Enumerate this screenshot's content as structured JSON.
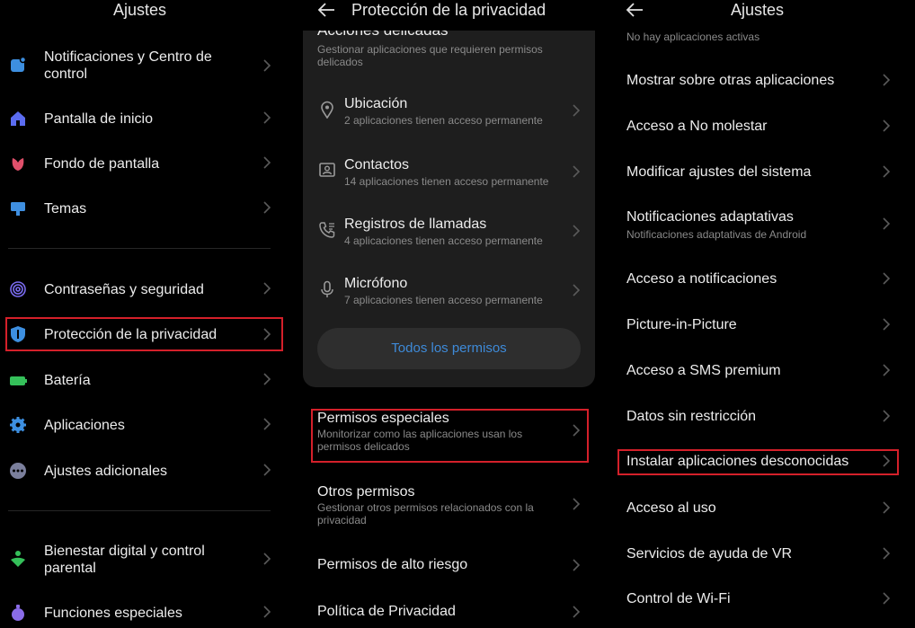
{
  "panel1": {
    "title": "Ajustes",
    "items": [
      {
        "label": "Notificaciones y Centro de",
        "label2": "control"
      },
      {
        "label": "Pantalla de inicio"
      },
      {
        "label": "Fondo de pantalla"
      },
      {
        "label": "Temas"
      },
      {
        "label": "Contraseñas y seguridad"
      },
      {
        "label": "Protección de la privacidad"
      },
      {
        "label": "Batería"
      },
      {
        "label": "Aplicaciones"
      },
      {
        "label": "Ajustes adicionales"
      },
      {
        "label": "Bienestar digital y control",
        "label2": "parental"
      },
      {
        "label": "Funciones especiales"
      }
    ]
  },
  "panel2": {
    "title": "Protección de la privacidad",
    "section_title": "Acciones delicadas",
    "section_sub1": "Gestionar aplicaciones que requieren permisos",
    "section_sub2": "delicados",
    "perms": [
      {
        "label": "Ubicación",
        "sub": "2 aplicaciones tienen acceso permanente"
      },
      {
        "label": "Contactos",
        "sub": "14 aplicaciones tienen acceso permanente"
      },
      {
        "label": "Registros de llamadas",
        "sub": "4 aplicaciones tienen acceso permanente"
      },
      {
        "label": "Micrófono",
        "sub": "7 aplicaciones tienen acceso permanente"
      }
    ],
    "all_perms": "Todos los permisos",
    "special": {
      "label": "Permisos especiales",
      "sub1": "Monitorizar como las aplicaciones usan los",
      "sub2": "permisos delicados"
    },
    "other": {
      "label": "Otros permisos",
      "sub1": "Gestionar otros permisos relacionados con la",
      "sub2": "privacidad"
    },
    "high_risk": "Permisos de alto riesgo",
    "policy": "Política de Privacidad"
  },
  "panel3": {
    "title": "Ajustes",
    "top_sub": "No hay aplicaciones activas",
    "items": [
      {
        "label": "Mostrar sobre otras aplicaciones"
      },
      {
        "label": "Acceso a No molestar"
      },
      {
        "label": "Modificar ajustes del sistema"
      },
      {
        "label": "Notificaciones adaptativas",
        "sub": "Notificaciones adaptativas de Android"
      },
      {
        "label": "Acceso a notificaciones"
      },
      {
        "label": "Picture-in-Picture"
      },
      {
        "label": "Acceso a SMS premium"
      },
      {
        "label": "Datos sin restricción"
      },
      {
        "label": "Instalar aplicaciones desconocidas"
      },
      {
        "label": "Acceso al uso"
      },
      {
        "label": "Servicios de ayuda de VR"
      },
      {
        "label": "Control de Wi-Fi"
      }
    ]
  },
  "colors": {
    "highlight": "#d4202a",
    "link": "#3e8ad8",
    "background": "#000000",
    "card": "#1e1e1e"
  }
}
